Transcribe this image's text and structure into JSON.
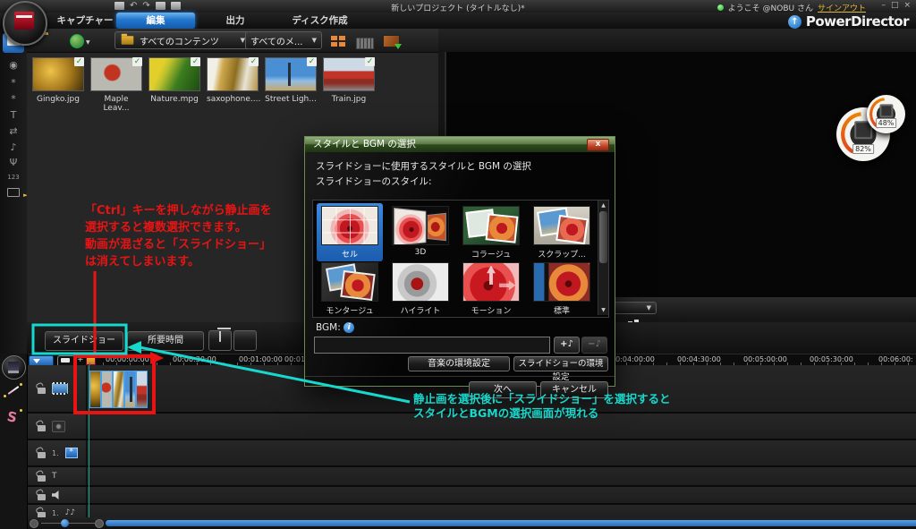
{
  "icons": {
    "check": "✓",
    "caret": "▼",
    "up": "▲",
    "down": "▼",
    "undo": "↶",
    "redo": "↷",
    "brand_arrow": "↑",
    "min": "–",
    "max": "□",
    "close": "×",
    "pip": "*",
    "title": "T",
    "transition": "⇄",
    "note": "♪",
    "notes": "♪♪",
    "mic": "Ψ",
    "chapter": "123",
    "fisheye": "◉",
    "expander": "►",
    "left": "◄"
  },
  "window": {
    "title": "新しいプロジェクト (タイトルなし)*",
    "welcome": "ようこそ @NOBU さん",
    "signout": "サインアウト",
    "brand": "PowerDirector",
    "tabs": [
      {
        "label": "キャプチャー"
      },
      {
        "label": "編集"
      },
      {
        "label": "出力"
      },
      {
        "label": "ディスク作成"
      }
    ]
  },
  "library": {
    "content_filter": "すべてのコンテンツ",
    "media_filter": "すべてのメ...",
    "items": [
      {
        "label": "Gingko.jpg"
      },
      {
        "label": "Maple Leav..."
      },
      {
        "label": "Nature.mpg"
      },
      {
        "label": "saxophone...."
      },
      {
        "label": "Street Ligh..."
      },
      {
        "label": "Train.jpg"
      }
    ]
  },
  "preview": {
    "gauge_outer": "82%",
    "gauge_inner": "48%"
  },
  "timeline": {
    "slideshow": "スライドショー",
    "duration": "所要時間",
    "ruler": [
      "00:00:00:00",
      "00:00:30:00",
      "00:01:00:00",
      "00:01",
      "00:04:00:00",
      "00:04:30:00",
      "00:05:00:00",
      "00:05:30:00",
      "00:06:00:"
    ],
    "track3_num": "1.",
    "track6_num": "1."
  },
  "dialog": {
    "title": "スタイルと BGM の選択",
    "close": "x",
    "subtitle": "スライドショーに使用するスタイルと BGM の選択",
    "styles_label": "スライドショーのスタイル:",
    "styles": [
      {
        "label": "セル"
      },
      {
        "label": "3D"
      },
      {
        "label": "コラージュ"
      },
      {
        "label": "スクラップ..."
      },
      {
        "label": "モンタージュ"
      },
      {
        "label": "ハイライト"
      },
      {
        "label": "モーション"
      },
      {
        "label": "標準"
      }
    ],
    "bgm_label": "BGM:",
    "bgm_info": "i",
    "add_bgm": "+♪",
    "remove_bgm": "−♪",
    "music_prefs": "音楽の環境設定",
    "slideshow_prefs": "スライドショーの環境設定",
    "next": "次へ",
    "cancel": "キャンセル"
  },
  "annotations": {
    "red": [
      "「Ctrl」キーを押しながら静止画を",
      "選択すると複数選択できます。",
      "動画が混ざると「スライドショー」",
      "は消えてしまいます。"
    ],
    "cyan": [
      "静止画を選択後に「スライドショー」を選択すると",
      "スタイルとBGMの選択画面が現れる"
    ]
  }
}
